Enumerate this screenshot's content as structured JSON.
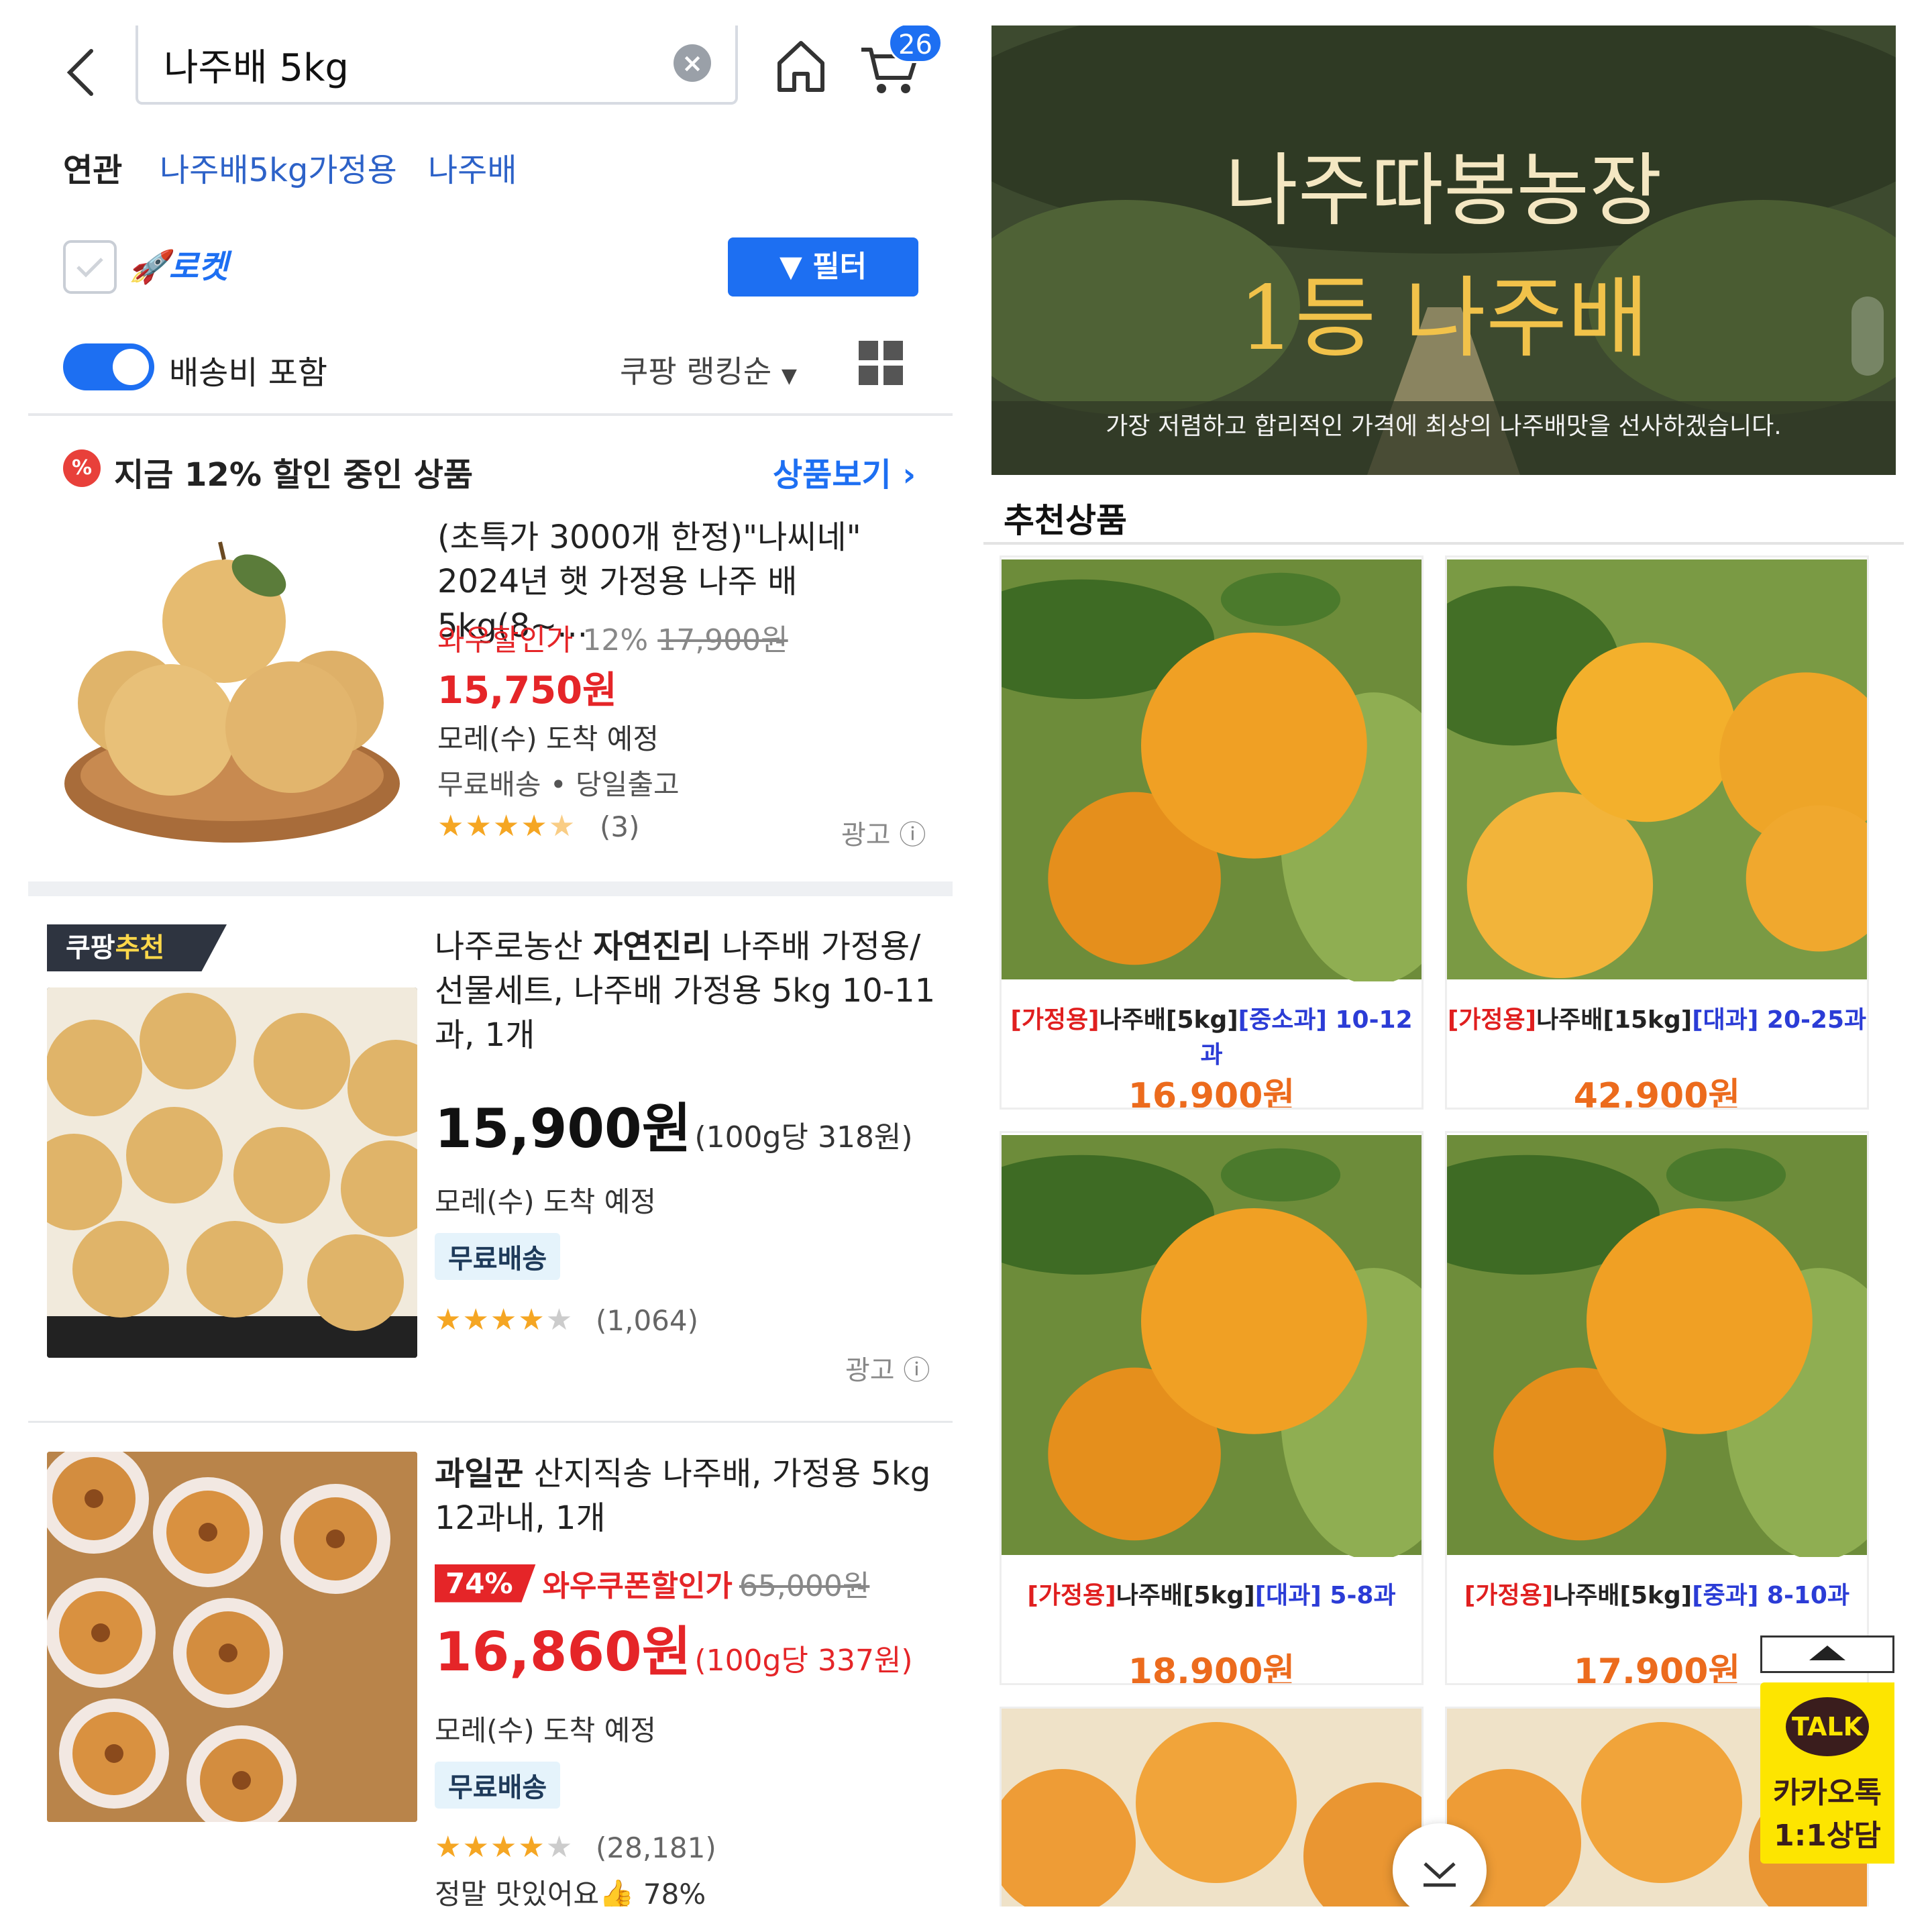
{
  "left": {
    "search": {
      "value": "나주배 5kg",
      "clear": "×"
    },
    "cart_badge": "26",
    "related": {
      "label": "연관",
      "links": [
        "나주배5kg가정용",
        "나주배"
      ]
    },
    "rocket_label": "로켓",
    "filter_label": "필터",
    "shipping_toggle_label": "배송비 포함",
    "sort_label": "쿠팡 랭킹순",
    "promo": {
      "title": "지금 12% 할인 중인 상품",
      "link": "상품보기 ›",
      "icon": "%"
    },
    "product1": {
      "title_line1": "(초특가 3000개 한정)\"나씨네\"",
      "title_line2": "2024년 햇 가정용 나주 배 5kg(8~...",
      "discount_label": "와우할인가",
      "discount_pct": "12%",
      "orig_price": "17,900원",
      "price": "15,750원",
      "arrival": "모레(수) 도착 예정",
      "shipping": "무료배송 • 당일출고",
      "rating": 4.5,
      "review_count": "(3)",
      "ad": "광고"
    },
    "product2": {
      "tag_a": "쿠팡",
      "tag_b": "추천",
      "brand_pre": "나주로농산 ",
      "brand_bold": "자연진리",
      "title_rest": " 나주배 가정용/",
      "title_line2": "선물세트, 나주배 가정용 5kg 10-11",
      "title_line3": "과, 1개",
      "price": "15,900원",
      "unit_price": "(100g당 318원)",
      "arrival": "모레(수) 도착 예정",
      "ship_badge": "무료배송",
      "rating": 4,
      "review_count": "(1,064)",
      "ad": "광고"
    },
    "product3": {
      "brand_bold": "과일꾼",
      "title_rest": " 산지직송 나주배, 가정용 5kg",
      "title_line2": "12과내, 1개",
      "discount_pct": "74%",
      "discount_label": "와우쿠폰할인가",
      "orig_price": "65,000원",
      "price": "16,860원",
      "unit_price": "(100g당 337원)",
      "arrival": "모레(수) 도착 예정",
      "ship_badge": "무료배송",
      "rating": 4,
      "review_count": "(28,181)",
      "review_text": "정말 맛있어요",
      "review_pct": "78%"
    }
  },
  "right": {
    "banner": {
      "title1": "나주따봉농장",
      "title2": "1등 나주배",
      "subtitle": "가장 저렴하고 합리적인 가격에 최상의 나주배맛을 선사하겠습니다."
    },
    "reco_heading": "추천상품",
    "cards": [
      {
        "tag": "[가정용]",
        "name": "나주배[5kg]",
        "size": "[중소과]",
        "count": " 10-12과",
        "price": "16,900원"
      },
      {
        "tag": "[가정용]",
        "name": "나주배[15kg]",
        "size": "[대과]",
        "count": " 20-25과",
        "price": "42,900원"
      },
      {
        "tag": "[가정용]",
        "name": "나주배[5kg]",
        "size": "[대과]",
        "count": " 5-8과",
        "price": "18,900원"
      },
      {
        "tag": "[가정용]",
        "name": "나주배[5kg]",
        "size": "[중과]",
        "count": " 8-10과",
        "price": "17,900원"
      }
    ],
    "kakao": {
      "talk": "TALK",
      "line1": "카카오톡",
      "line2": "1:1상담"
    }
  },
  "colors": {
    "accent": "#1d6ff2",
    "sale": "#e52528",
    "price_orange": "#ec6b1d",
    "kakao": "#fde500"
  }
}
